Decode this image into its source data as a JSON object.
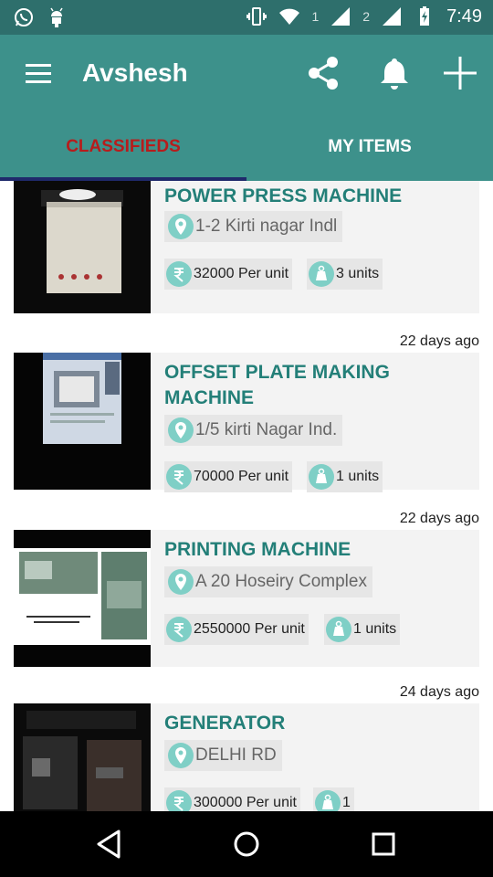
{
  "status_bar": {
    "time": "7:49",
    "sim1": "1",
    "sim2": "2",
    "icons": [
      "whatsapp-icon",
      "android-icon",
      "vibrate-icon",
      "wifi-icon",
      "signal-icon",
      "battery-charging-icon"
    ]
  },
  "app_bar": {
    "title": "Avshesh",
    "icons": [
      "menu-icon",
      "share-icon",
      "bell-icon",
      "plus-icon"
    ]
  },
  "tabs": [
    {
      "label": "CLASSIFIEDS",
      "active": true
    },
    {
      "label": "MY ITEMS",
      "active": false
    }
  ],
  "listings": [
    {
      "time_ago": "",
      "title": "POWER PRESS MACHINE",
      "location": "1-2 Kirti nagar Indl",
      "price": "32000 Per unit",
      "quantity": "3 units"
    },
    {
      "time_ago": "22 days ago",
      "title": "OFFSET PLATE MAKING MACHINE",
      "location": "1/5 kirti Nagar Ind.",
      "price": "70000 Per unit",
      "quantity": "1 units"
    },
    {
      "time_ago": "22 days ago",
      "title": "PRINTING MACHINE",
      "location": "A 20 Hoseiry Complex",
      "price": "2550000 Per unit",
      "quantity": "1 units"
    },
    {
      "time_ago": "24 days ago",
      "title": "GENERATOR",
      "location": "DELHI RD",
      "price": "300000 Per unit",
      "quantity": "1"
    }
  ],
  "nav_bar": {
    "icons": [
      "back-icon",
      "home-icon",
      "recents-icon"
    ]
  },
  "colors": {
    "status_bar": "#2e6f6c",
    "app_bar": "#3d918b",
    "title_text": "#237f78",
    "active_tab": "#b71c1c",
    "icon_circle": "#7fcfc6"
  }
}
